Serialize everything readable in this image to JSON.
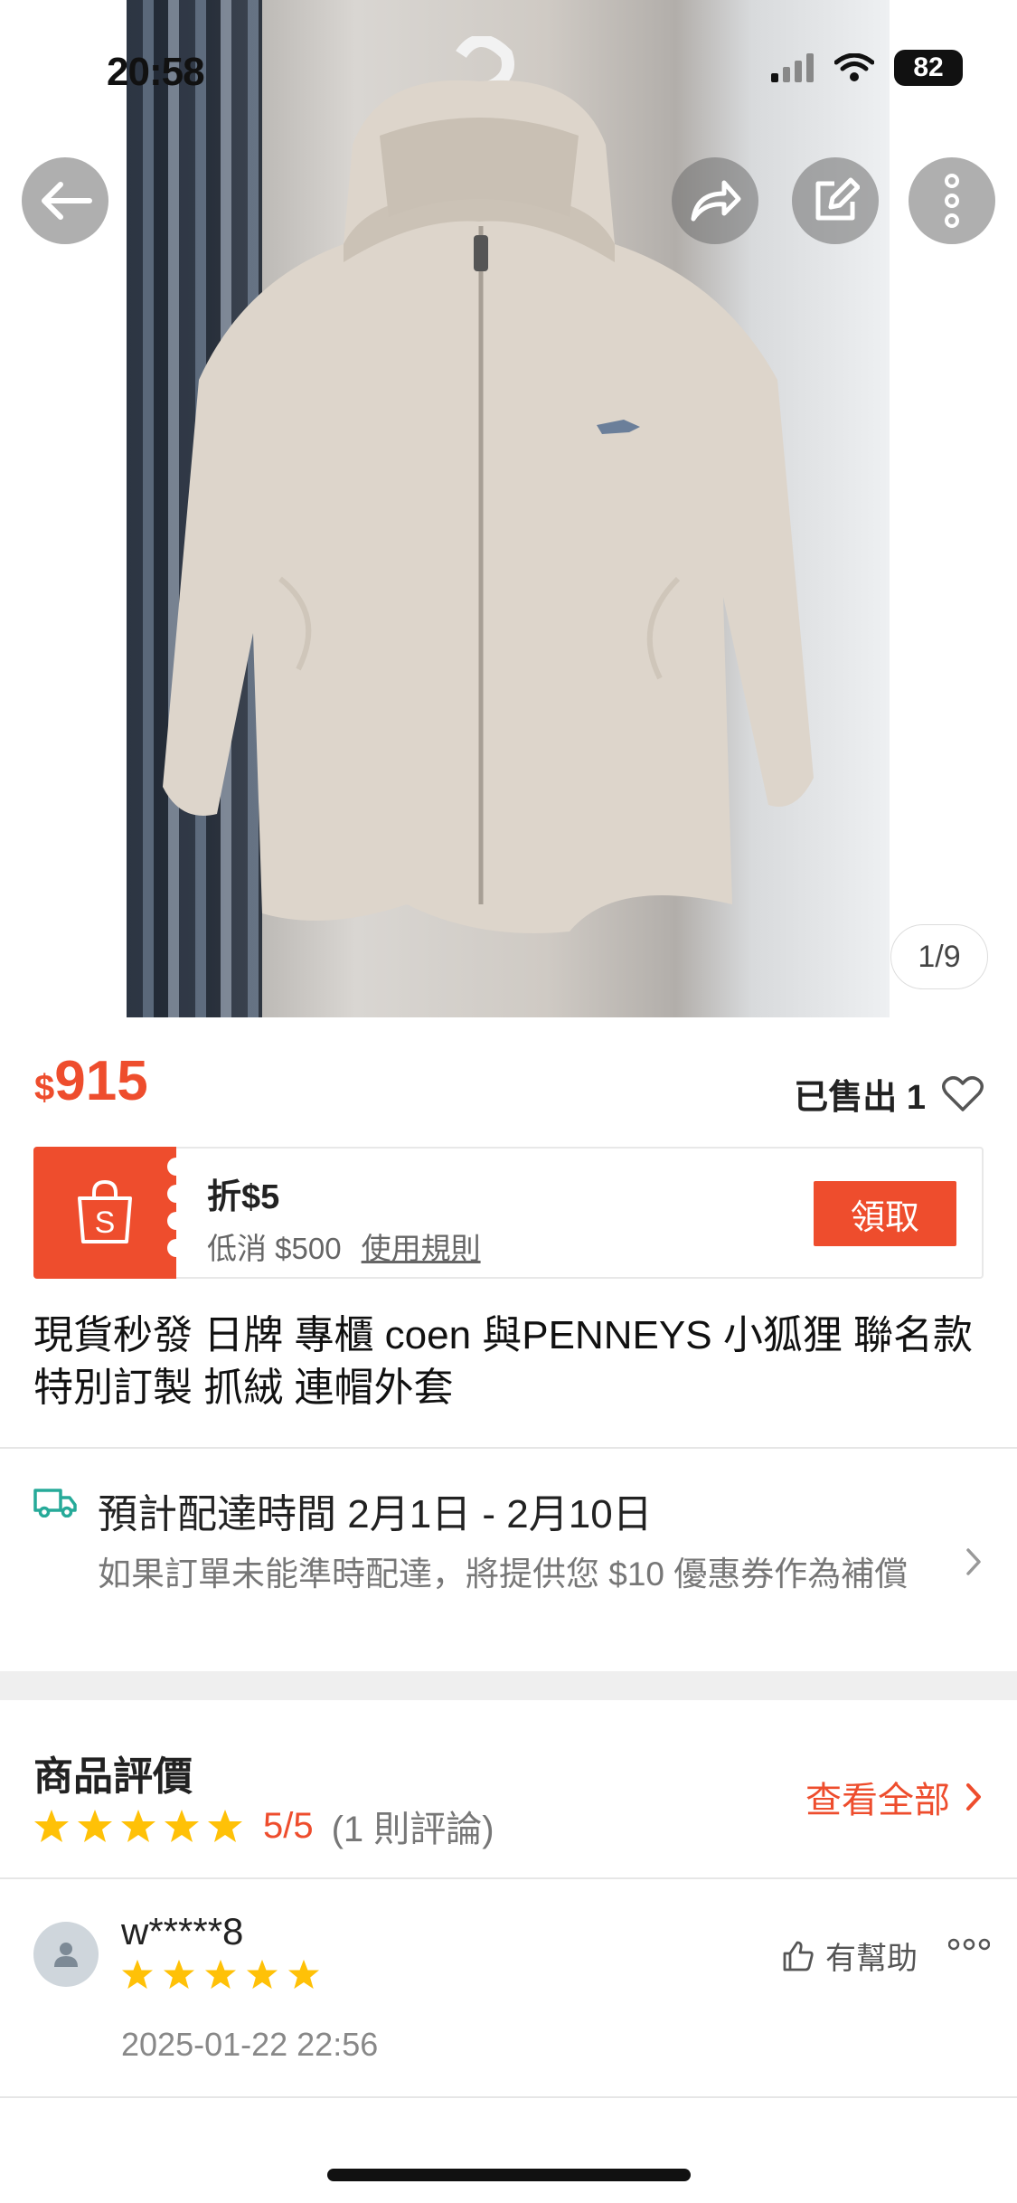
{
  "status_bar": {
    "time": "20:58",
    "battery": "82"
  },
  "gallery": {
    "counter": "1/9"
  },
  "product": {
    "currency": "$",
    "price": "915",
    "sold": "已售出 1",
    "title": "現貨秒發 日牌 專櫃 coen 與PENNEYS 小狐狸 聯名款 特別訂製 抓絨 連帽外套"
  },
  "voucher": {
    "title": "折$5",
    "min_spend": "低消 $500",
    "rules": "使用規則",
    "claim": "領取"
  },
  "shipping": {
    "title": "預計配達時間 2月1日 - 2月10日",
    "note": "如果訂單未能準時配達，將提供您 $10 優惠券作為補償"
  },
  "reviews": {
    "title": "商品評價",
    "score": "5/5",
    "count": "(1 則評論)",
    "see_all": "查看全部",
    "items": [
      {
        "user": "w*****8",
        "date": "2025-01-22 22:56",
        "helpful": "有幫助",
        "stars": 5
      }
    ]
  },
  "colors": {
    "accent": "#ee4d2d",
    "star": "#ffc107",
    "ship_icon": "#26aa99"
  }
}
